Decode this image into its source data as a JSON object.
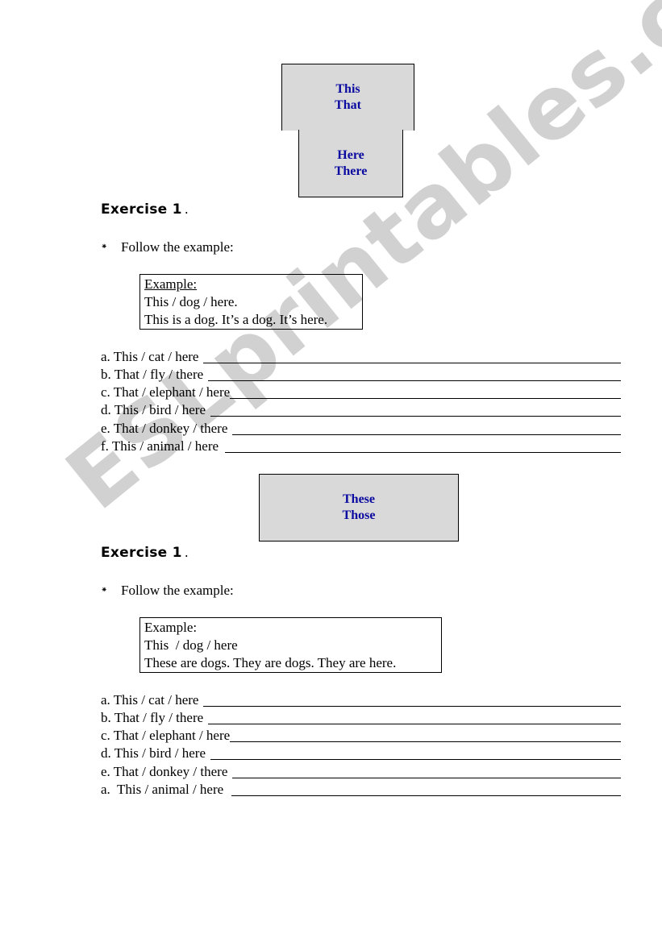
{
  "watermark": "ESLprintables.com",
  "colors": {
    "box_fill": "#d9d9d9",
    "box_text": "#0a0aa0",
    "watermark": "#cfcfcf"
  },
  "top_box": {
    "upper": [
      "This",
      "That"
    ],
    "lower": [
      "Here",
      "There"
    ]
  },
  "section1": {
    "heading": "Exercise 1",
    "heading_suffix": ".",
    "bullet_icon": "asterisk-bullet",
    "bullet": "⁕",
    "instruction": "Follow the example:",
    "example": {
      "title": "Example:",
      "line1": "This / dog / here.",
      "line2": "This is a dog. It’s a dog. It’s here."
    },
    "items": [
      "a. This / cat / here",
      "b. That / fly / there",
      "c. That / elephant / here",
      "d. This / bird / here",
      "e. That / donkey / there",
      "f. This / animal / here"
    ]
  },
  "middle_box": {
    "lines": [
      "These",
      "Those"
    ]
  },
  "section2": {
    "heading": "Exercise 1",
    "heading_suffix": ".",
    "bullet_icon": "asterisk-bullet",
    "bullet": "⁕",
    "instruction": "Follow the example:",
    "example": {
      "title": "Example:",
      "line1": "This  / dog / here",
      "line2": "These are dogs. They are dogs. They are here."
    },
    "items": [
      "a. This / cat / here",
      "b. That / fly / there",
      "c. That / elephant / here",
      "d. This / bird / here",
      "e. That / donkey / there",
      "a.  This / animal / here"
    ]
  }
}
